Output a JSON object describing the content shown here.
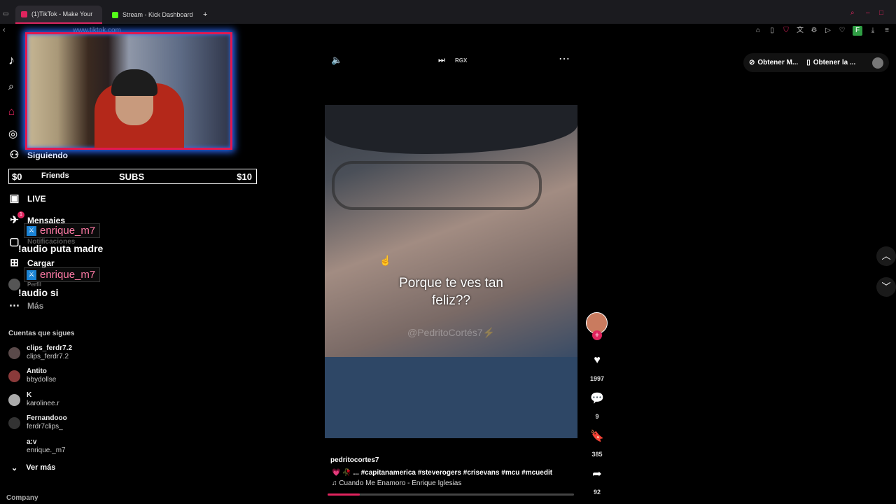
{
  "browser": {
    "tabs": [
      {
        "title": "(1)TikTok - Make Your"
      },
      {
        "title": "Stream - Kick Dashboard"
      }
    ],
    "new_tab": "+",
    "url": "www.tiktok.com"
  },
  "sidebar": {
    "items": [
      {
        "label": "Siguiendo",
        "icon": "following-icon"
      },
      {
        "label": "Friends",
        "icon": "friends-icon"
      },
      {
        "label": "LIVE",
        "icon": "live-icon"
      },
      {
        "label": "Mensajes",
        "icon": "messages-icon"
      },
      {
        "label": "Notificaciones",
        "icon": "notifications-icon"
      },
      {
        "label": "Cargar",
        "icon": "upload-icon"
      },
      {
        "label": "Perfil",
        "icon": "profile-icon"
      },
      {
        "label": "Más",
        "icon": "more-icon"
      }
    ],
    "messages_badge": "1",
    "following_title": "Cuentas que sigues",
    "accounts": [
      {
        "name": "clips_ferdr7.2",
        "handle": "clips_ferdr7.2"
      },
      {
        "name": "Antito",
        "handle": "bbydollse"
      },
      {
        "name": "K",
        "handle": "karolinee.r"
      },
      {
        "name": "Fernandooo",
        "handle": "ferdr7clips_"
      },
      {
        "name": "a:v",
        "handle": "enrique._m7"
      }
    ],
    "see_more": "Ver más",
    "company": "Company"
  },
  "subs_goal": {
    "left": "$0",
    "label": "SUBS",
    "right": "$10"
  },
  "chat": [
    {
      "user": "enrique_m7",
      "message": "!audio puta madre"
    },
    {
      "user": "enrique_m7",
      "message": "!audio si"
    }
  ],
  "video": {
    "subtitle_line1": "Porque te ves tan",
    "subtitle_line2": "feliz??",
    "watermark": "@PedritoCortés7⚡",
    "author": "pedritocortes7",
    "description": "💗 🥀 ... #capitanamerica #steverogers #crisevans #mcu #mcuedit",
    "music": "♫ Cuando Me Enamoro - Enrique Iglesias",
    "progress": 0.13,
    "top_label": "RGX"
  },
  "actions": {
    "likes": "1997",
    "comments": "9",
    "saves": "385",
    "shares": "92"
  },
  "top_right": {
    "pill1": "Obtener M...",
    "pill2": "Obtener la ..."
  },
  "colors": {
    "accent": "#e0245e",
    "chat_name": "#ff7aa6",
    "webcam_border": "#e3184f"
  }
}
